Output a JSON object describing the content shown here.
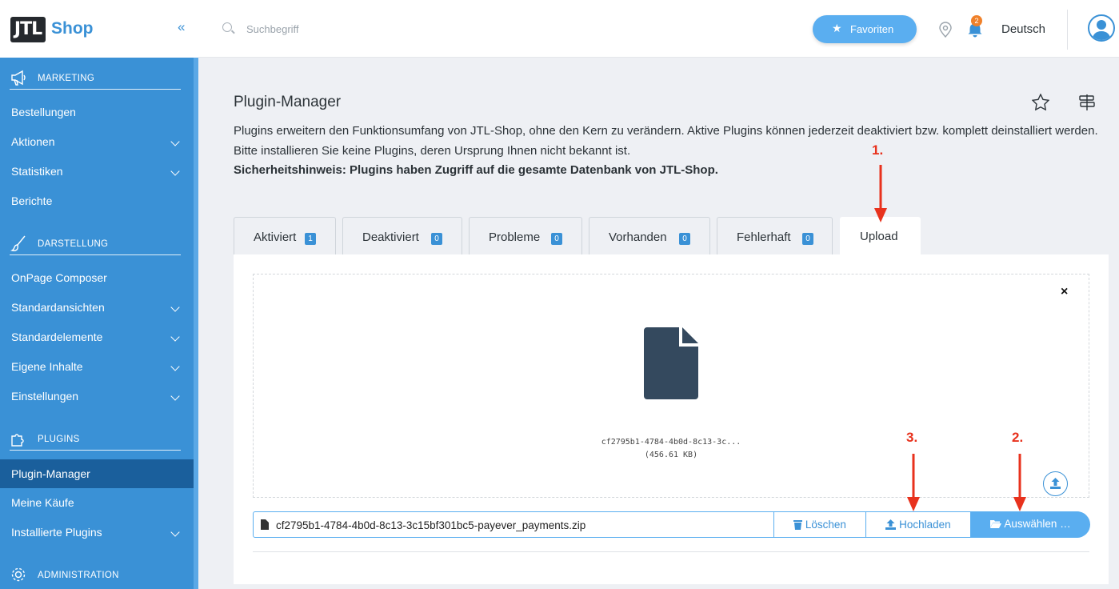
{
  "logo": {
    "mark": "JTL",
    "name": "Shop",
    "collapse_icon": "«"
  },
  "sidebar": {
    "sections": [
      {
        "label": "MARKETING",
        "icon": "megaphone-icon"
      },
      {
        "label": "DARSTELLUNG",
        "icon": "brush-icon"
      },
      {
        "label": "PLUGINS",
        "icon": "puzzle-icon"
      },
      {
        "label": "ADMINISTRATION",
        "icon": "gear-icon"
      }
    ],
    "items": [
      {
        "label": "Bestellungen",
        "expandable": false
      },
      {
        "label": "Aktionen",
        "expandable": true
      },
      {
        "label": "Statistiken",
        "expandable": true
      },
      {
        "label": "Berichte",
        "expandable": false
      },
      {
        "label": "OnPage Composer",
        "expandable": false
      },
      {
        "label": "Standardansichten",
        "expandable": true
      },
      {
        "label": "Standardelemente",
        "expandable": true
      },
      {
        "label": "Eigene Inhalte",
        "expandable": true
      },
      {
        "label": "Einstellungen",
        "expandable": true
      },
      {
        "label": "Plugin-Manager",
        "expandable": false,
        "active": true
      },
      {
        "label": "Meine Käufe",
        "expandable": false
      },
      {
        "label": "Installierte Plugins",
        "expandable": true
      }
    ]
  },
  "topbar": {
    "search_placeholder": "Suchbegriff",
    "favorites_label": "Favoriten",
    "notification_count": "2",
    "language": "Deutsch"
  },
  "page": {
    "title": "Plugin-Manager",
    "description": "Plugins erweitern den Funktionsumfang von JTL-Shop, ohne den Kern zu verändern. Aktive Plugins können jederzeit deaktiviert bzw. komplett deinstalliert werden. Bitte installieren Sie keine Plugins, deren Ursprung Ihnen nicht bekannt ist.",
    "warning": "Sicherheitshinweis: Plugins haben Zugriff auf die gesamte Datenbank von JTL-Shop."
  },
  "tabs": [
    {
      "label": "Aktiviert",
      "count": "1"
    },
    {
      "label": "Deaktiviert",
      "count": "0"
    },
    {
      "label": "Probleme",
      "count": "0"
    },
    {
      "label": "Vorhanden",
      "count": "0"
    },
    {
      "label": "Fehlerhaft",
      "count": "0"
    },
    {
      "label": "Upload",
      "active": true
    }
  ],
  "upload": {
    "preview_filename": "cf2795b1-4784-4b0d-8c13-3c...",
    "preview_size": "(456.61 KB)",
    "close_symbol": "×",
    "file_path": "cf2795b1-4784-4b0d-8c13-3c15bf301bc5-payever_payments.zip",
    "delete_label": "Löschen",
    "upload_label": "Hochladen",
    "select_label": "Auswählen …"
  },
  "annotations": [
    "1.",
    "2.",
    "3."
  ],
  "colors": {
    "primary": "#3a91d6",
    "accent": "#5aaef0",
    "active_nav": "#1a5f9c",
    "annotation": "#e8321d",
    "badge": "#f0812a"
  }
}
